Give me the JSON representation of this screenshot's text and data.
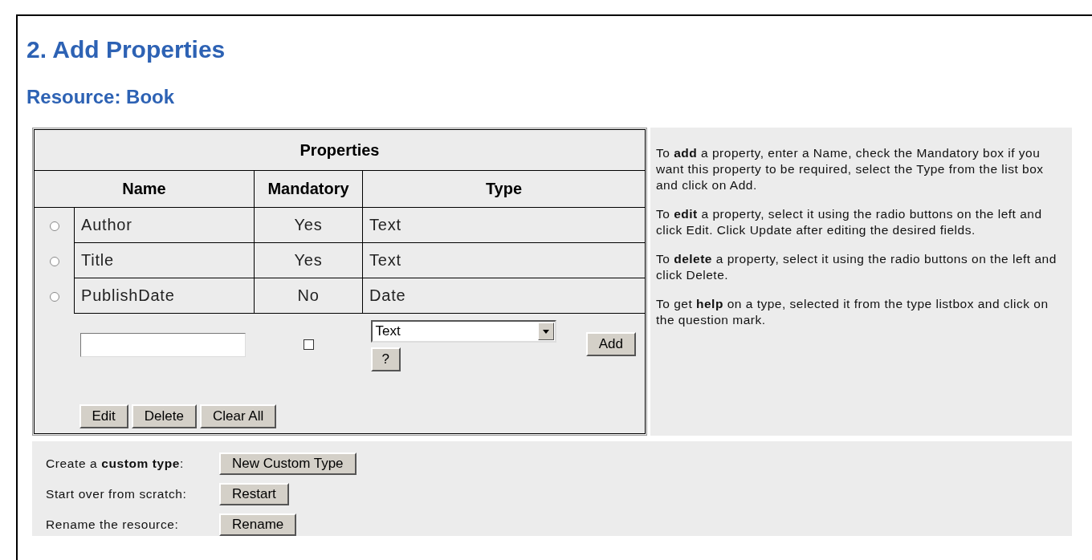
{
  "heading": "2. Add Properties",
  "subheading": "Resource: Book",
  "properties_table": {
    "title": "Properties",
    "columns": [
      "Name",
      "Mandatory",
      "Type"
    ],
    "rows": [
      {
        "selected": false,
        "name": "Author",
        "mandatory": "Yes",
        "type": "Text"
      },
      {
        "selected": false,
        "name": "Title",
        "mandatory": "Yes",
        "type": "Text"
      },
      {
        "selected": false,
        "name": "PublishDate",
        "mandatory": "No",
        "type": "Date"
      }
    ]
  },
  "new_property": {
    "mandatory_checked": false,
    "type_select": "Text",
    "help_button": "?",
    "add_button": "Add"
  },
  "table_buttons": [
    "Edit",
    "Delete",
    "Clear All"
  ],
  "help_text": [
    "To **add** a property, enter a Name, check the Mandatory box if you want this property to be required, select the Type from the list box and click on Add.",
    "To **edit** a property, select it using the radio buttons on the left and click Edit. Click Update after editing the desired fields.",
    "To **delete** a property, select it using the radio buttons on the left and click Delete.",
    "To get **help** on a type, selected it from the type listbox and click on the question mark."
  ],
  "actions": [
    {
      "label": "Create a **custom type**:",
      "button": "New Custom Type"
    },
    {
      "label": "Start over from scratch:",
      "button": "Restart"
    },
    {
      "label": "Rename the resource:",
      "button": "Rename"
    }
  ]
}
